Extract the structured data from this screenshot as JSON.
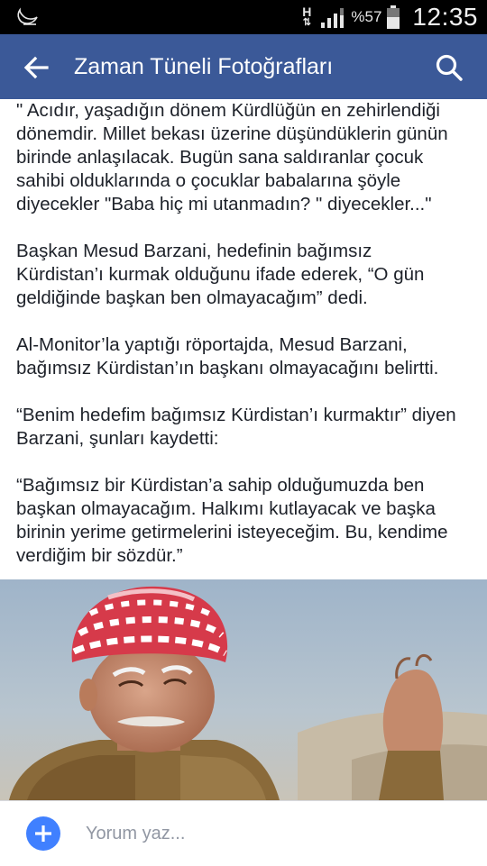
{
  "status_bar": {
    "network_type": "H",
    "battery_percent": "%57",
    "time": "12:35"
  },
  "app_bar": {
    "title": "Zaman Tüneli Fotoğrafları"
  },
  "article": {
    "paragraphs": [
      {
        "lines": [
          "\" Acıdır, yaşadığın dönem Kürdlüğün en zehirlendiği",
          "dönemdir. Millet bekası üzerine düşündüklerin günün",
          "birinde anlaşılacak. Bugün sana saldıranlar çocuk",
          "sahibi olduklarında o çocuklar babalarına şöyle",
          "diyecekler \"Baba hiç mi utanmadın? \" diyecekler...\""
        ]
      },
      {
        "lines": [
          "Başkan Mesud Barzani, hedefinin bağımsız",
          "Kürdistan’ı kurmak olduğunu ifade ederek, “O gün",
          "geldiğinde başkan ben olmayacağım” dedi."
        ]
      },
      {
        "lines": [
          "Al-Monitor’la yaptığı röportajda, Mesud Barzani,",
          "bağımsız Kürdistan’ın başkanı olmayacağını belirtti."
        ]
      },
      {
        "lines": [
          "“Benim hedefim bağımsız Kürdistan’ı kurmaktır” diyen",
          "Barzani, şunları kaydetti:"
        ]
      },
      {
        "lines": [
          "“Bağımsız bir Kürdistan’a sahip olduğumuzda ben",
          "başkan olmayacağım. Halkımı kutlayacak ve başka",
          "birinin yerime getirmelerini isteyeceğim. Bu, kendime",
          "verdiğim bir sözdür.”"
        ]
      }
    ]
  },
  "photo": {
    "subject": "man-in-red-white-turban-photo"
  },
  "comment_bar": {
    "placeholder": "Yorum yaz...",
    "add_icon": "plus-icon"
  },
  "colors": {
    "app_bar": "#3b5998",
    "add_button": "#4080ff",
    "status_bar": "#000000"
  }
}
